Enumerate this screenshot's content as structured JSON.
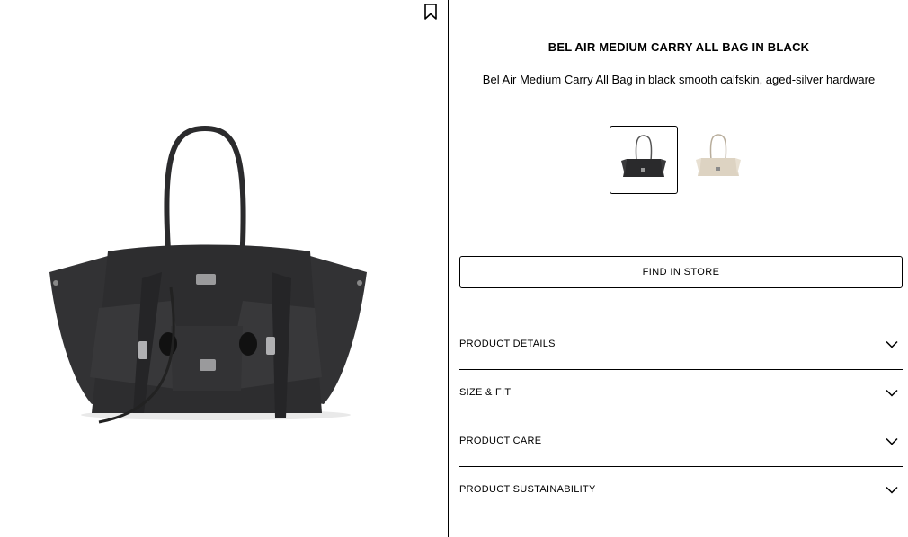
{
  "product": {
    "title": "BEL AIR MEDIUM CARRY ALL BAG IN BLACK",
    "description": "Bel Air Medium Carry All Bag in black smooth calfskin, aged-silver hardware"
  },
  "gallery": {
    "bookmark_icon": "bookmark-icon",
    "main_image_color": "#2b2b2d"
  },
  "swatches": [
    {
      "color_name": "black",
      "hex": "#2a2a2c",
      "selected": true
    },
    {
      "color_name": "beige",
      "hex": "#ddd3c2",
      "selected": false
    }
  ],
  "actions": {
    "find_in_store": "FIND IN STORE"
  },
  "accordion": [
    {
      "label": "PRODUCT DETAILS",
      "icon": "chevron-down-icon"
    },
    {
      "label": "SIZE & FIT",
      "icon": "chevron-down-icon"
    },
    {
      "label": "PRODUCT CARE",
      "icon": "chevron-down-icon"
    },
    {
      "label": "PRODUCT SUSTAINABILITY",
      "icon": "chevron-down-icon"
    }
  ]
}
